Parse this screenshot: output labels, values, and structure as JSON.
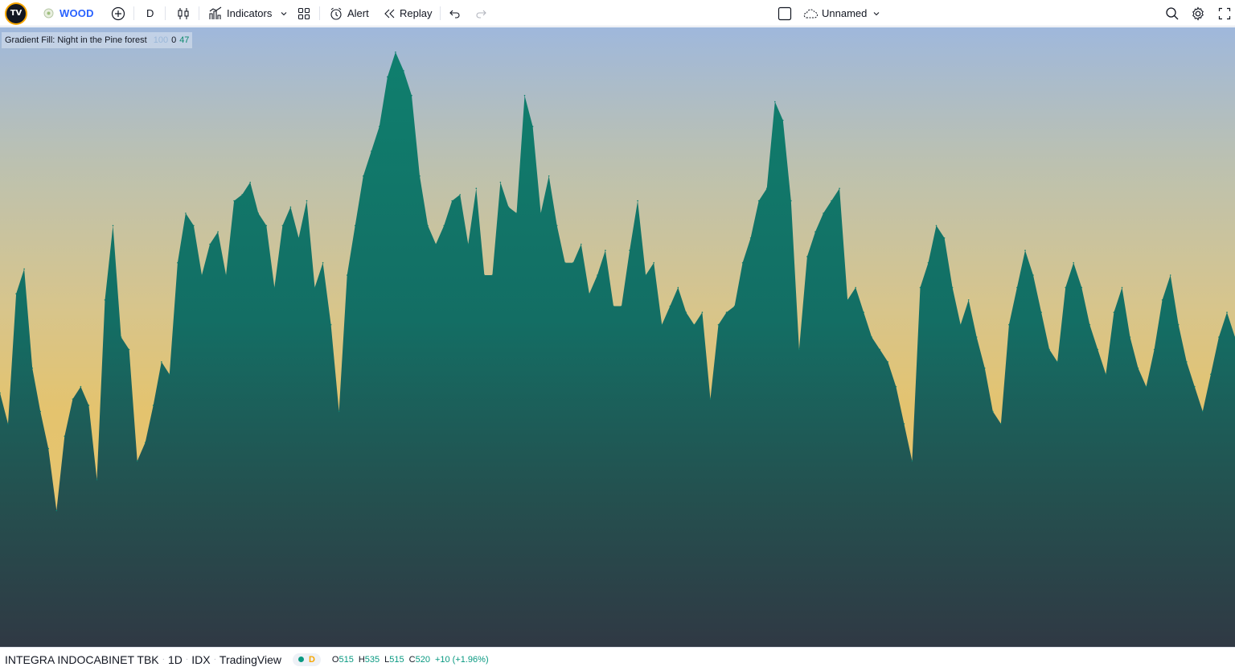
{
  "toolbar": {
    "logo_text": "TV",
    "symbol": "WOOD",
    "interval": "D",
    "indicators_label": "Indicators",
    "alert_label": "Alert",
    "replay_label": "Replay",
    "layout_name": "Unnamed",
    "icons": [
      "add-symbol-icon",
      "candles-icon",
      "indicators-icon",
      "chevron-down-icon",
      "templates-icon",
      "alert-icon",
      "replay-icon",
      "undo-icon",
      "redo-icon",
      "layout-square-icon",
      "cloud-icon",
      "search-icon",
      "gear-icon",
      "fullscreen-icon"
    ]
  },
  "legend": {
    "title": "Gradient Fill: Night in the Pine forest",
    "val1": "100",
    "val2": "0",
    "val3": "47"
  },
  "status": {
    "name": "INTEGRA INDOCABINET TBK",
    "interval": "1D",
    "exchange": "IDX",
    "source": "TradingView",
    "pill_label": "D",
    "open_label": "O",
    "open": "515",
    "high_label": "H",
    "high": "535",
    "low_label": "L",
    "low": "515",
    "close_label": "C",
    "close": "520",
    "change": "+10 (+1.96%)"
  },
  "colors": {
    "fill_top": "#0f7f6e",
    "fill_bottom": "#2f3a46",
    "sky_top": "#9fb8dc",
    "sky_bottom": "#e6c370",
    "up": "#089981",
    "brand": "#2962ff"
  },
  "chart_data": {
    "type": "area",
    "title": "Gradient Fill: Night in the Pine forest",
    "xlabel": "",
    "ylabel": "",
    "ylim": [
      0,
      100
    ],
    "grid": false,
    "legend": "top-left",
    "x": [
      0,
      1,
      2,
      3,
      4,
      5,
      6,
      7,
      8,
      9,
      10,
      11,
      12,
      13,
      14,
      15,
      16,
      17,
      18,
      19,
      20,
      21,
      22,
      23,
      24,
      25,
      26,
      27,
      28,
      29,
      30,
      31,
      32,
      33,
      34,
      35,
      36,
      37,
      38,
      39,
      40,
      41,
      42,
      43,
      44,
      45,
      46,
      47,
      48,
      49,
      50,
      51,
      52,
      53,
      54,
      55,
      56,
      57,
      58,
      59,
      60,
      61,
      62,
      63,
      64,
      65,
      66,
      67,
      68,
      69,
      70,
      71,
      72,
      73,
      74,
      75,
      76,
      77,
      78,
      79,
      80,
      81,
      82,
      83,
      84,
      85,
      86,
      87,
      88,
      89,
      90,
      91,
      92,
      93,
      94,
      95,
      96,
      97,
      98,
      99,
      100,
      101,
      102,
      103,
      104,
      105,
      106,
      107,
      108,
      109,
      110,
      111,
      112,
      113,
      114,
      115,
      116,
      117,
      118,
      119,
      120,
      121,
      122,
      123,
      124,
      125,
      126,
      127,
      128,
      129,
      130,
      131,
      132,
      133,
      134,
      135,
      136,
      137,
      138,
      139,
      140,
      141,
      142,
      143,
      144,
      145,
      146,
      147,
      148,
      149,
      150,
      151,
      152,
      153
    ],
    "series": [
      {
        "values": [
          41,
          36,
          57,
          61,
          45,
          38,
          32,
          22,
          34,
          40,
          42,
          39,
          27,
          56,
          68,
          50,
          48,
          30,
          33,
          39,
          46,
          44,
          62,
          70,
          68,
          60,
          65,
          67,
          60,
          72,
          73,
          75,
          70,
          68,
          58,
          68,
          71,
          66,
          72,
          58,
          62,
          52,
          38,
          60,
          68,
          76,
          80,
          84,
          92,
          96,
          93,
          89,
          76,
          68,
          65,
          68,
          72,
          73,
          65,
          74,
          60,
          60,
          75,
          71,
          70,
          89,
          84,
          70,
          76,
          68,
          62,
          62,
          65,
          57,
          60,
          64,
          55,
          55,
          64,
          72,
          60,
          62,
          52,
          55,
          58,
          54,
          52,
          54,
          40,
          52,
          54,
          55,
          62,
          66,
          72,
          74,
          88,
          85,
          72,
          48,
          63,
          67,
          70,
          72,
          74,
          56,
          58,
          54,
          50,
          48,
          46,
          42,
          36,
          30,
          58,
          62,
          68,
          66,
          58,
          52,
          56,
          50,
          45,
          38,
          36,
          52,
          58,
          64,
          60,
          54,
          48,
          46,
          58,
          62,
          58,
          52,
          48,
          44,
          54,
          58,
          50,
          45,
          42,
          48,
          56,
          60,
          52,
          46,
          42,
          38,
          44,
          50,
          54,
          50
        ]
      }
    ]
  }
}
